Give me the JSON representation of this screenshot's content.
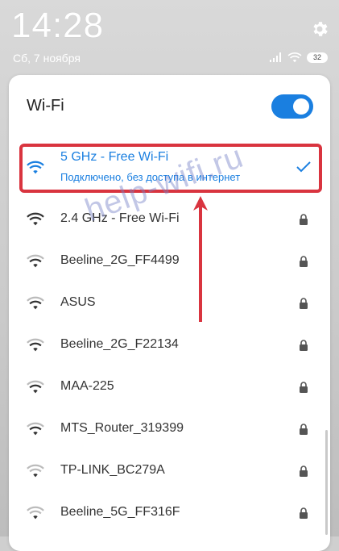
{
  "status": {
    "time": "14:28",
    "date": "Сб, 7 ноября",
    "battery": "32"
  },
  "wifi_panel": {
    "title": "Wi-Fi",
    "toggle_on": true,
    "connected": {
      "name": "5 GHz - Free Wi-Fi",
      "status": "Подключено, без доступа в интернет"
    },
    "networks": [
      {
        "name": "2.4 GHz - Free Wi-Fi"
      },
      {
        "name": "Beeline_2G_FF4499"
      },
      {
        "name": "ASUS"
      },
      {
        "name": "Beeline_2G_F22134"
      },
      {
        "name": "MAA-225"
      },
      {
        "name": "MTS_Router_319399"
      },
      {
        "name": "TP-LINK_BC279A"
      },
      {
        "name": "Beeline_5G_FF316F"
      }
    ]
  },
  "watermark": "help-wifi.ru",
  "colors": {
    "accent": "#1a7fe0",
    "highlight": "#d9343f"
  }
}
